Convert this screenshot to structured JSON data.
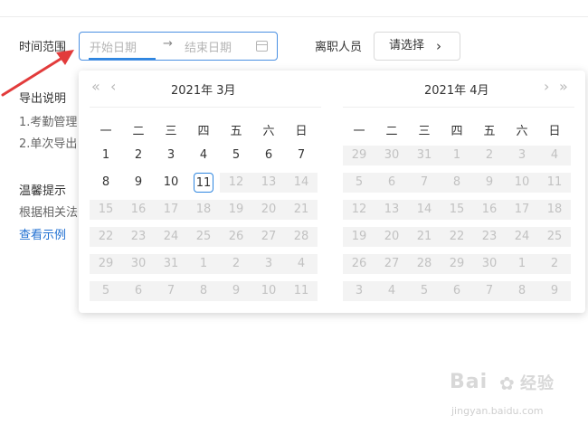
{
  "filters": {
    "range_label": "时间范围",
    "start_placeholder": "开始日期",
    "range_separator": "→",
    "end_placeholder": "结束日期",
    "resigned_label": "离职人员",
    "select_label": "请选择",
    "select_chevron": "›"
  },
  "left_panel": {
    "export_title": "导出说明",
    "line1": "1.考勤管理",
    "line2": "2.单次导出",
    "tip_title": "温馨提示",
    "tip_line": "根据相关法",
    "example_link": "查看示例"
  },
  "calendar": {
    "left": {
      "header": "2021年  3月",
      "nav_prev_year": "«",
      "nav_prev_month": "‹",
      "weekdays": [
        "一",
        "二",
        "三",
        "四",
        "五",
        "六",
        "日"
      ],
      "rows": [
        [
          [
            "1",
            "cur"
          ],
          [
            "2",
            "cur"
          ],
          [
            "3",
            "cur"
          ],
          [
            "4",
            "cur"
          ],
          [
            "5",
            "cur"
          ],
          [
            "6",
            "cur"
          ],
          [
            "7",
            "cur"
          ]
        ],
        [
          [
            "8",
            "cur"
          ],
          [
            "9",
            "cur"
          ],
          [
            "10",
            "cur"
          ],
          [
            "11",
            "today"
          ],
          [
            "12",
            "dis"
          ],
          [
            "13",
            "dis"
          ],
          [
            "14",
            "dis"
          ]
        ],
        [
          [
            "15",
            "dis"
          ],
          [
            "16",
            "dis"
          ],
          [
            "17",
            "dis"
          ],
          [
            "18",
            "dis"
          ],
          [
            "19",
            "dis"
          ],
          [
            "20",
            "dis"
          ],
          [
            "21",
            "dis"
          ]
        ],
        [
          [
            "22",
            "dis"
          ],
          [
            "23",
            "dis"
          ],
          [
            "24",
            "dis"
          ],
          [
            "25",
            "dis"
          ],
          [
            "26",
            "dis"
          ],
          [
            "27",
            "dis"
          ],
          [
            "28",
            "dis"
          ]
        ],
        [
          [
            "29",
            "dis"
          ],
          [
            "30",
            "dis"
          ],
          [
            "31",
            "dis"
          ],
          [
            "1",
            "dis"
          ],
          [
            "2",
            "dis"
          ],
          [
            "3",
            "dis"
          ],
          [
            "4",
            "dis"
          ]
        ],
        [
          [
            "5",
            "dis"
          ],
          [
            "6",
            "dis"
          ],
          [
            "7",
            "dis"
          ],
          [
            "8",
            "dis"
          ],
          [
            "9",
            "dis"
          ],
          [
            "10",
            "dis"
          ],
          [
            "11",
            "dis"
          ]
        ]
      ]
    },
    "right": {
      "header": "2021年  4月",
      "nav_next_month": "›",
      "nav_next_year": "»",
      "weekdays": [
        "一",
        "二",
        "三",
        "四",
        "五",
        "六",
        "日"
      ],
      "rows": [
        [
          [
            "29",
            "dis"
          ],
          [
            "30",
            "dis"
          ],
          [
            "31",
            "dis"
          ],
          [
            "1",
            "dis"
          ],
          [
            "2",
            "dis"
          ],
          [
            "3",
            "dis"
          ],
          [
            "4",
            "dis"
          ]
        ],
        [
          [
            "5",
            "dis"
          ],
          [
            "6",
            "dis"
          ],
          [
            "7",
            "dis"
          ],
          [
            "8",
            "dis"
          ],
          [
            "9",
            "dis"
          ],
          [
            "10",
            "dis"
          ],
          [
            "11",
            "dis"
          ]
        ],
        [
          [
            "12",
            "dis"
          ],
          [
            "13",
            "dis"
          ],
          [
            "14",
            "dis"
          ],
          [
            "15",
            "dis"
          ],
          [
            "16",
            "dis"
          ],
          [
            "17",
            "dis"
          ],
          [
            "18",
            "dis"
          ]
        ],
        [
          [
            "19",
            "dis"
          ],
          [
            "20",
            "dis"
          ],
          [
            "21",
            "dis"
          ],
          [
            "22",
            "dis"
          ],
          [
            "23",
            "dis"
          ],
          [
            "24",
            "dis"
          ],
          [
            "25",
            "dis"
          ]
        ],
        [
          [
            "26",
            "dis"
          ],
          [
            "27",
            "dis"
          ],
          [
            "28",
            "dis"
          ],
          [
            "29",
            "dis"
          ],
          [
            "30",
            "dis"
          ],
          [
            "1",
            "dis"
          ],
          [
            "2",
            "dis"
          ]
        ],
        [
          [
            "3",
            "dis"
          ],
          [
            "4",
            "dis"
          ],
          [
            "5",
            "dis"
          ],
          [
            "6",
            "dis"
          ],
          [
            "7",
            "dis"
          ],
          [
            "8",
            "dis"
          ],
          [
            "9",
            "dis"
          ]
        ]
      ]
    }
  },
  "watermark": {
    "text": "Bai",
    "text2": "经验",
    "url": "jingyan.baidu.com"
  },
  "colors": {
    "accent": "#2f86e0",
    "arrow": "#e23b3b",
    "link": "#1f6fd1"
  }
}
